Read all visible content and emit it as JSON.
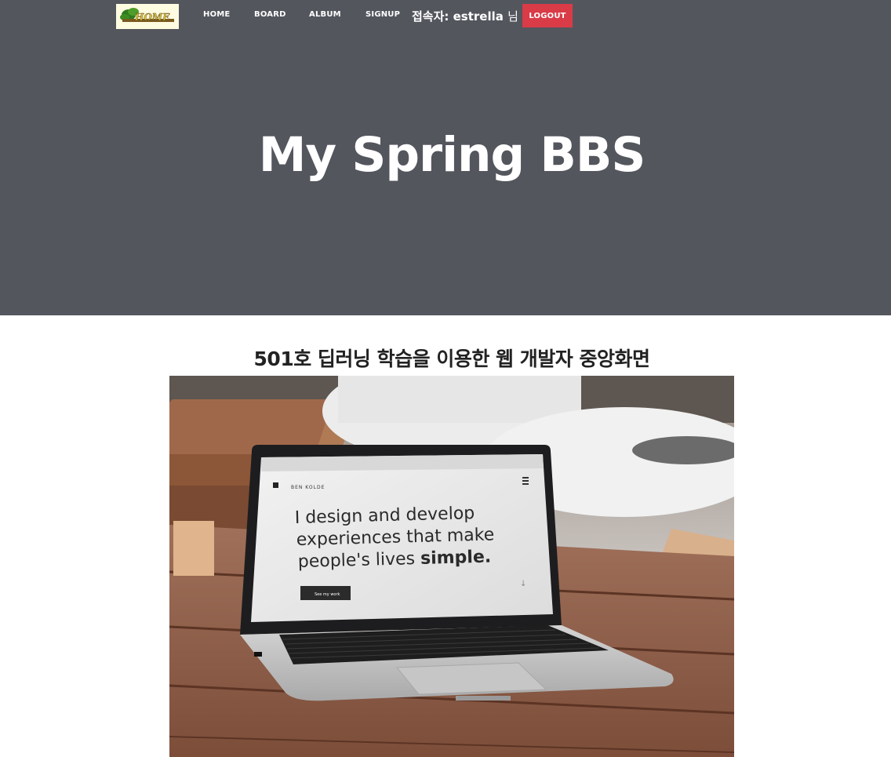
{
  "nav": {
    "logo_text": "HOME",
    "links": [
      "HOME",
      "BOARD",
      "ALBUM",
      "SIGNUP"
    ],
    "user_label": "접속자: estrella",
    "user_suffix": "님",
    "logout_label": "LOGOUT"
  },
  "hero": {
    "title": "My Spring BBS"
  },
  "main": {
    "heading": "501호 딥러닝 학습을 이용한 웹 개발자 중앙화면",
    "photo": {
      "site_brand": "BEN KOLDE",
      "headline_lines": [
        "I design and develop",
        "experiences that make",
        "people's lives "
      ],
      "headline_bold": "simple.",
      "cta_label": "See my work"
    }
  },
  "colors": {
    "hero_bg": "#54565e",
    "logout_bg": "#d93b47",
    "text_dark": "#222222"
  }
}
